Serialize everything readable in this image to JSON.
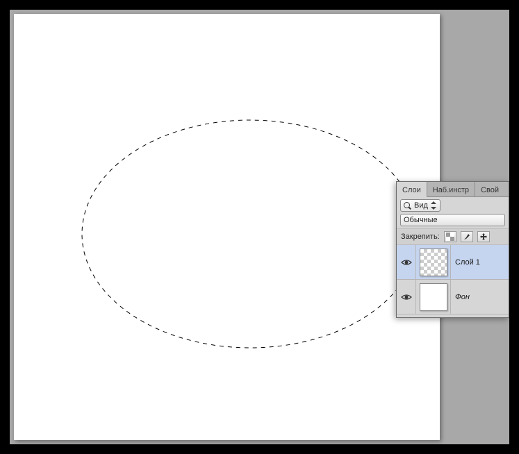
{
  "panel": {
    "tabs": {
      "layers": "Слои",
      "channels": "Наб.инстр",
      "paths": "Свой"
    },
    "filter": {
      "label": "Вид"
    },
    "blend_mode": "Обычные",
    "lock": {
      "label": "Закрепить:"
    },
    "layers": [
      {
        "name": "Слой 1",
        "type": "transparent",
        "visible": true,
        "selected": true
      },
      {
        "name": "Фон",
        "type": "background",
        "visible": true,
        "selected": false
      }
    ]
  }
}
